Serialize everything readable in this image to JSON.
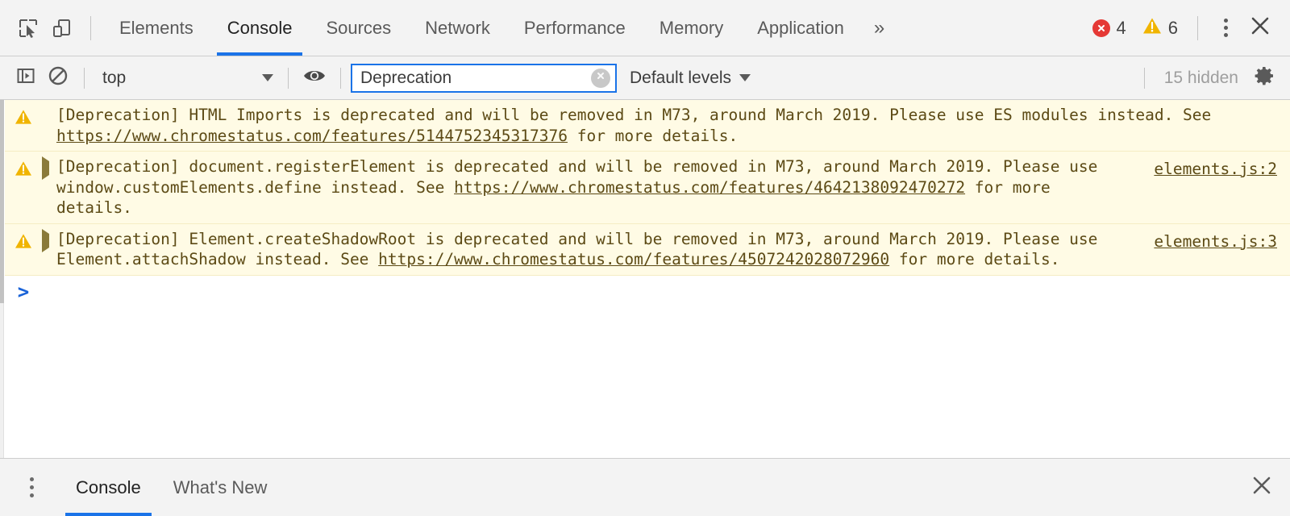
{
  "main_tabbar": {
    "inspect_icon": "inspect-element-icon",
    "device_icon": "device-toolbar-icon",
    "tabs": [
      {
        "label": "Elements",
        "active": false
      },
      {
        "label": "Console",
        "active": true
      },
      {
        "label": "Sources",
        "active": false
      },
      {
        "label": "Network",
        "active": false
      },
      {
        "label": "Performance",
        "active": false
      },
      {
        "label": "Memory",
        "active": false
      },
      {
        "label": "Application",
        "active": false
      }
    ],
    "overflow_label": "»",
    "error_count": "4",
    "warning_count": "6",
    "error_color": "#e53935",
    "warning_color": "#f0b400",
    "accent_color": "#1a73e8",
    "menu_icon": "kebab-menu-icon",
    "close_icon": "close-icon"
  },
  "console_toolbar": {
    "sidebar_toggle_icon": "console-sidebar-toggle-icon",
    "clear_icon": "clear-console-icon",
    "context": {
      "value": "top",
      "caret_icon": "chevron-down-icon"
    },
    "eye_icon": "live-expression-eye-icon",
    "filter": {
      "value": "Deprecation",
      "placeholder": "Filter",
      "clear_icon": "clear-filter-icon"
    },
    "levels": {
      "label": "Default levels",
      "caret_icon": "chevron-down-icon"
    },
    "hidden_label": "15 hidden",
    "settings_icon": "gear-icon"
  },
  "console_messages": [
    {
      "level": "warning",
      "icon": "warning-triangle-icon",
      "expandable": false,
      "parts": [
        {
          "type": "text",
          "value": "[Deprecation] HTML Imports is deprecated and will be removed in M73, around March 2019. Please use ES modules instead. See "
        },
        {
          "type": "link",
          "value": "https://www.chromestatus.com/features/5144752345317376"
        },
        {
          "type": "text",
          "value": " for more details."
        }
      ],
      "source": ""
    },
    {
      "level": "warning",
      "icon": "warning-triangle-icon",
      "expandable": true,
      "parts": [
        {
          "type": "text",
          "value": "[Deprecation] document.registerElement is deprecated and will be removed in M73, around March 2019. Please use window.customElements.define instead. See "
        },
        {
          "type": "link",
          "value": "https://www.chromestatus.com/features/4642138092470272"
        },
        {
          "type": "text",
          "value": " for more details."
        }
      ],
      "source": "elements.js:2"
    },
    {
      "level": "warning",
      "icon": "warning-triangle-icon",
      "expandable": true,
      "parts": [
        {
          "type": "text",
          "value": "[Deprecation] Element.createShadowRoot is deprecated and will be removed in M73, around March 2019. Please use Element.attachShadow instead. See "
        },
        {
          "type": "link",
          "value": "https://www.chromestatus.com/features/4507242028072960"
        },
        {
          "type": "text",
          "value": " for more details."
        }
      ],
      "source": "elements.js:3"
    }
  ],
  "prompt": {
    "marker": ">",
    "value": "",
    "marker_color": "#1a63d8"
  },
  "drawer": {
    "menu_icon": "kebab-menu-icon",
    "tabs": [
      {
        "label": "Console",
        "active": true
      },
      {
        "label": "What's New",
        "active": false
      }
    ],
    "close_icon": "close-icon"
  },
  "theme": {
    "warning_bg": "#fffbe5",
    "warning_text": "#5c4a15",
    "toolbar_bg": "#f3f3f3",
    "body_bg": "#ffffff"
  }
}
